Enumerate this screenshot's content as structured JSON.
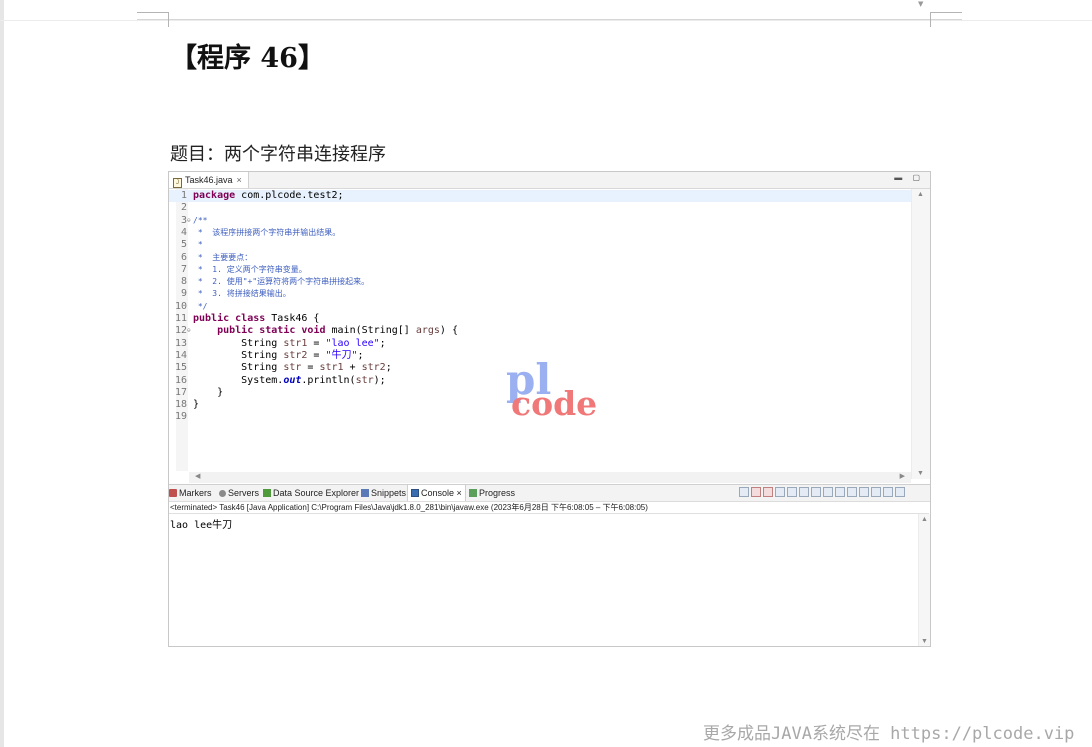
{
  "document": {
    "title": "【程序 46】",
    "subject": "题目：两个字符串连接程序"
  },
  "editor": {
    "tab_label": "Task46.java",
    "tab_close": "×",
    "view_controls": "▬ ▢",
    "lines": [
      {
        "num": "1",
        "fold": "",
        "current": true,
        "segments": [
          {
            "t": "kw",
            "v": "package"
          },
          {
            "t": "",
            "v": " com.plcode.test2;"
          }
        ]
      },
      {
        "num": "2",
        "fold": "",
        "segments": []
      },
      {
        "num": "3",
        "fold": "⊖",
        "segments": [
          {
            "t": "cm",
            "v": "/**"
          }
        ]
      },
      {
        "num": "4",
        "fold": "",
        "segments": [
          {
            "t": "cm",
            "v": " *  该程序拼接两个字符串并输出结果。"
          }
        ]
      },
      {
        "num": "5",
        "fold": "",
        "segments": [
          {
            "t": "cm",
            "v": " *"
          }
        ]
      },
      {
        "num": "6",
        "fold": "",
        "segments": [
          {
            "t": "cm",
            "v": " *  主要要点："
          }
        ]
      },
      {
        "num": "7",
        "fold": "",
        "segments": [
          {
            "t": "cm",
            "v": " *  1. 定义两个字符串变量。"
          }
        ]
      },
      {
        "num": "8",
        "fold": "",
        "segments": [
          {
            "t": "cm",
            "v": " *  2. 使用\"+\"运算符将两个字符串拼接起来。"
          }
        ]
      },
      {
        "num": "9",
        "fold": "",
        "segments": [
          {
            "t": "cm",
            "v": " *  3. 将拼接结果输出。"
          }
        ]
      },
      {
        "num": "10",
        "fold": "",
        "segments": [
          {
            "t": "cm",
            "v": " */"
          }
        ]
      },
      {
        "num": "11",
        "fold": "",
        "segments": [
          {
            "t": "kw",
            "v": "public"
          },
          {
            "t": "",
            "v": " "
          },
          {
            "t": "kw",
            "v": "class"
          },
          {
            "t": "",
            "v": " Task46 {"
          }
        ]
      },
      {
        "num": "12",
        "fold": "⊖",
        "segments": [
          {
            "t": "",
            "v": "    "
          },
          {
            "t": "kw",
            "v": "public"
          },
          {
            "t": "",
            "v": " "
          },
          {
            "t": "kw",
            "v": "static"
          },
          {
            "t": "",
            "v": " "
          },
          {
            "t": "kw",
            "v": "void"
          },
          {
            "t": "",
            "v": " main(String[] "
          },
          {
            "t": "loc",
            "v": "args"
          },
          {
            "t": "",
            "v": ") {"
          }
        ]
      },
      {
        "num": "13",
        "fold": "",
        "segments": [
          {
            "t": "",
            "v": "        String "
          },
          {
            "t": "loc",
            "v": "str1"
          },
          {
            "t": "",
            "v": " = "
          },
          {
            "t": "str",
            "v": "\"lao lee\""
          },
          {
            "t": "",
            "v": ";"
          }
        ]
      },
      {
        "num": "14",
        "fold": "",
        "segments": [
          {
            "t": "",
            "v": "        String "
          },
          {
            "t": "loc",
            "v": "str2"
          },
          {
            "t": "",
            "v": " = "
          },
          {
            "t": "str",
            "v": "\"牛刀\""
          },
          {
            "t": "",
            "v": ";"
          }
        ]
      },
      {
        "num": "15",
        "fold": "",
        "segments": [
          {
            "t": "",
            "v": "        String "
          },
          {
            "t": "loc",
            "v": "str"
          },
          {
            "t": "",
            "v": " = "
          },
          {
            "t": "loc",
            "v": "str1"
          },
          {
            "t": "",
            "v": " + "
          },
          {
            "t": "loc",
            "v": "str2"
          },
          {
            "t": "",
            "v": ";"
          }
        ]
      },
      {
        "num": "16",
        "fold": "",
        "segments": [
          {
            "t": "",
            "v": "        System."
          },
          {
            "t": "fld",
            "v": "out"
          },
          {
            "t": "",
            "v": ".println("
          },
          {
            "t": "loc",
            "v": "str"
          },
          {
            "t": "",
            "v": ");"
          }
        ]
      },
      {
        "num": "17",
        "fold": "",
        "segments": [
          {
            "t": "",
            "v": "    }"
          }
        ]
      },
      {
        "num": "18",
        "fold": "",
        "segments": [
          {
            "t": "",
            "v": "}"
          }
        ]
      },
      {
        "num": "19",
        "fold": "",
        "segments": []
      }
    ],
    "watermark_pl": "pl",
    "watermark_code": "code"
  },
  "bottom_panel": {
    "tabs": [
      {
        "label": "Markers",
        "icon": "markers-icon",
        "active": false
      },
      {
        "label": "Servers",
        "icon": "servers-icon",
        "active": false
      },
      {
        "label": "Data Source Explorer",
        "icon": "data-source-explorer-icon",
        "active": false
      },
      {
        "label": "Snippets",
        "icon": "snippets-icon",
        "active": false
      },
      {
        "label": "Console",
        "icon": "console-icon",
        "active": true
      },
      {
        "label": "Progress",
        "icon": "progress-icon",
        "active": false
      }
    ],
    "console_close": "×",
    "console_header": "<terminated> Task46 [Java Application] C:\\Program Files\\Java\\jdk1.8.0_281\\bin\\javaw.exe  (2023年6月28日 下午6:08:05 – 下午6:08:05)",
    "console_output": "lao lee牛刀"
  },
  "footer_watermark": "更多成品JAVA系统尽在 https://plcode.vip",
  "colors": {
    "keyword": "#7f0055",
    "comment": "#3f5fbf",
    "string": "#2a00ff",
    "field": "#0000c0",
    "watermark_pl": "#9ab0f0",
    "watermark_code": "#f07878"
  }
}
